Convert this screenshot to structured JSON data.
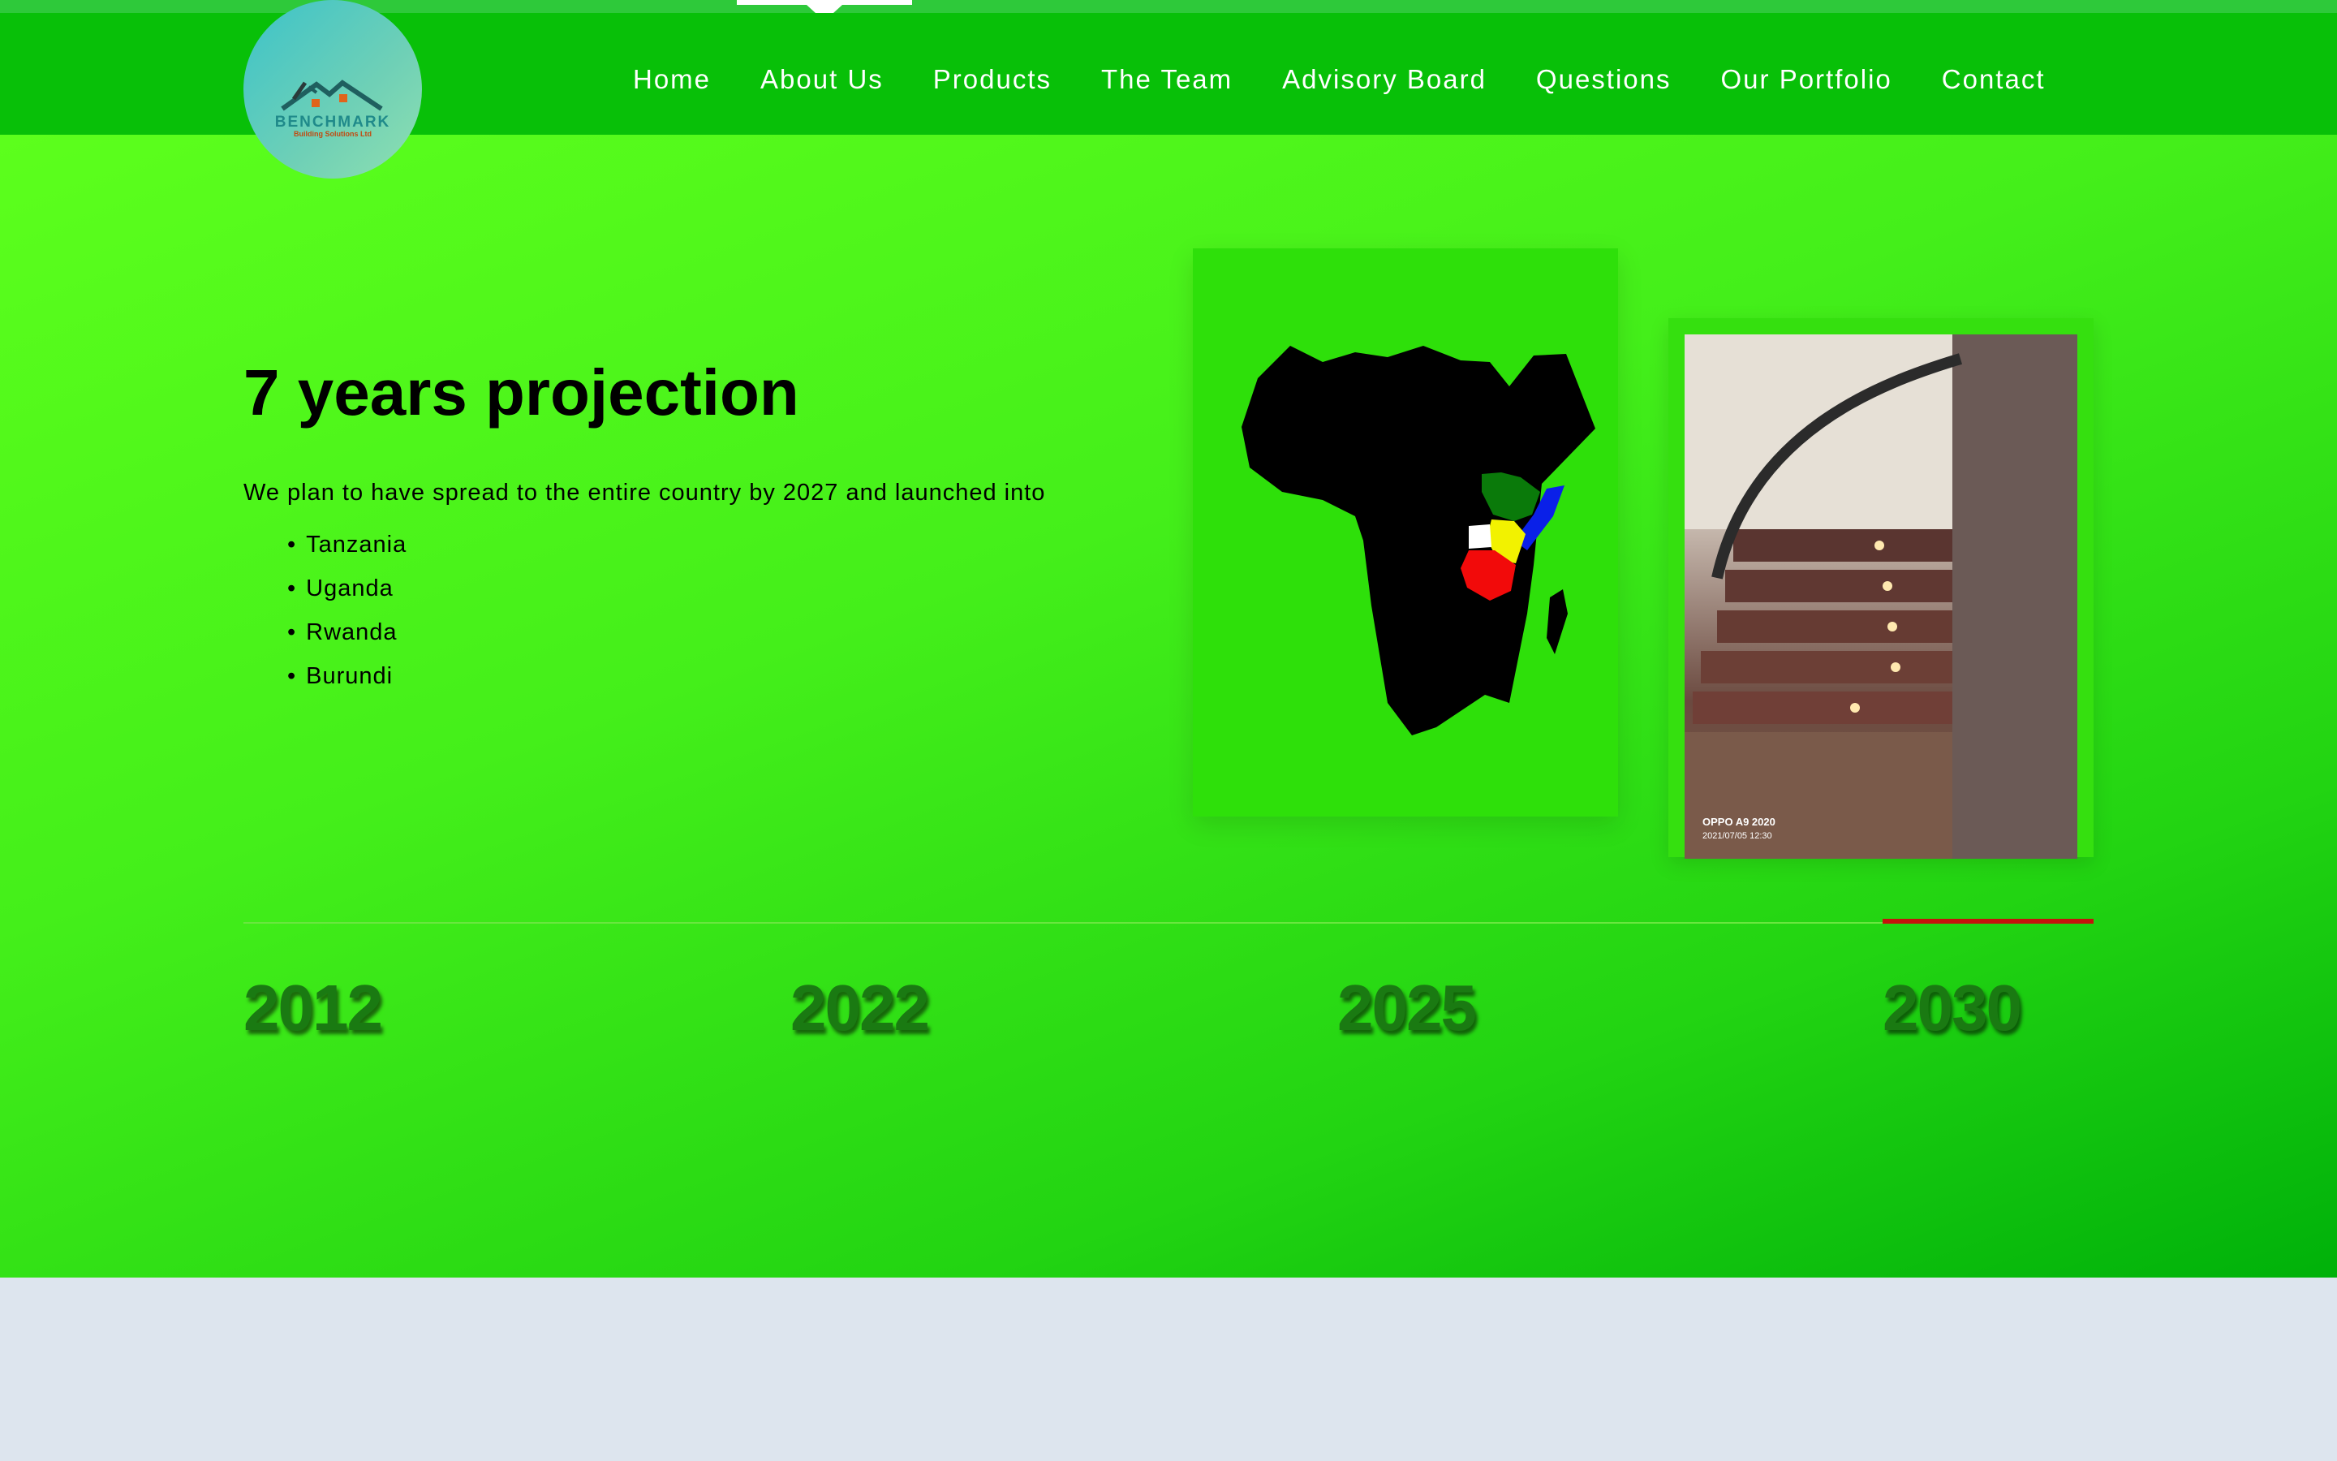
{
  "header": {
    "logo": {
      "name": "BENCHMARK",
      "tagline": "Building Solutions Ltd"
    },
    "nav": {
      "items": [
        "Home",
        "About Us",
        "Products",
        "The Team",
        "Advisory Board",
        "Questions",
        "Our Portfolio",
        "Contact"
      ],
      "active": "About Us"
    }
  },
  "hero": {
    "title": "7 years projection",
    "intro": "We plan to have spread to the entire country by 2027 and launched into",
    "countries": [
      "Tanzania",
      "Uganda",
      "Rwanda",
      "Burundi"
    ],
    "map_region_colors": {
      "Ethiopia": "#0a7a0a",
      "Somalia": "#0a20e8",
      "Kenya": "#f2f200",
      "Uganda": "#ffffff",
      "Tanzania": "#f20a0a",
      "rest_of_africa": "#000000"
    },
    "photo": {
      "caption": "OPPO A9 2020",
      "date": "2021/07/05 12:30"
    }
  },
  "timeline": {
    "years": [
      "2012",
      "2022",
      "2025",
      "2030"
    ],
    "active": "2030"
  },
  "colors": {
    "header_bg": "#08c008",
    "hero_gradient_start": "#5cff1c",
    "hero_gradient_end": "#00b10a",
    "timeline_active": "#c4140c",
    "page_bg": "#dde5ee"
  }
}
